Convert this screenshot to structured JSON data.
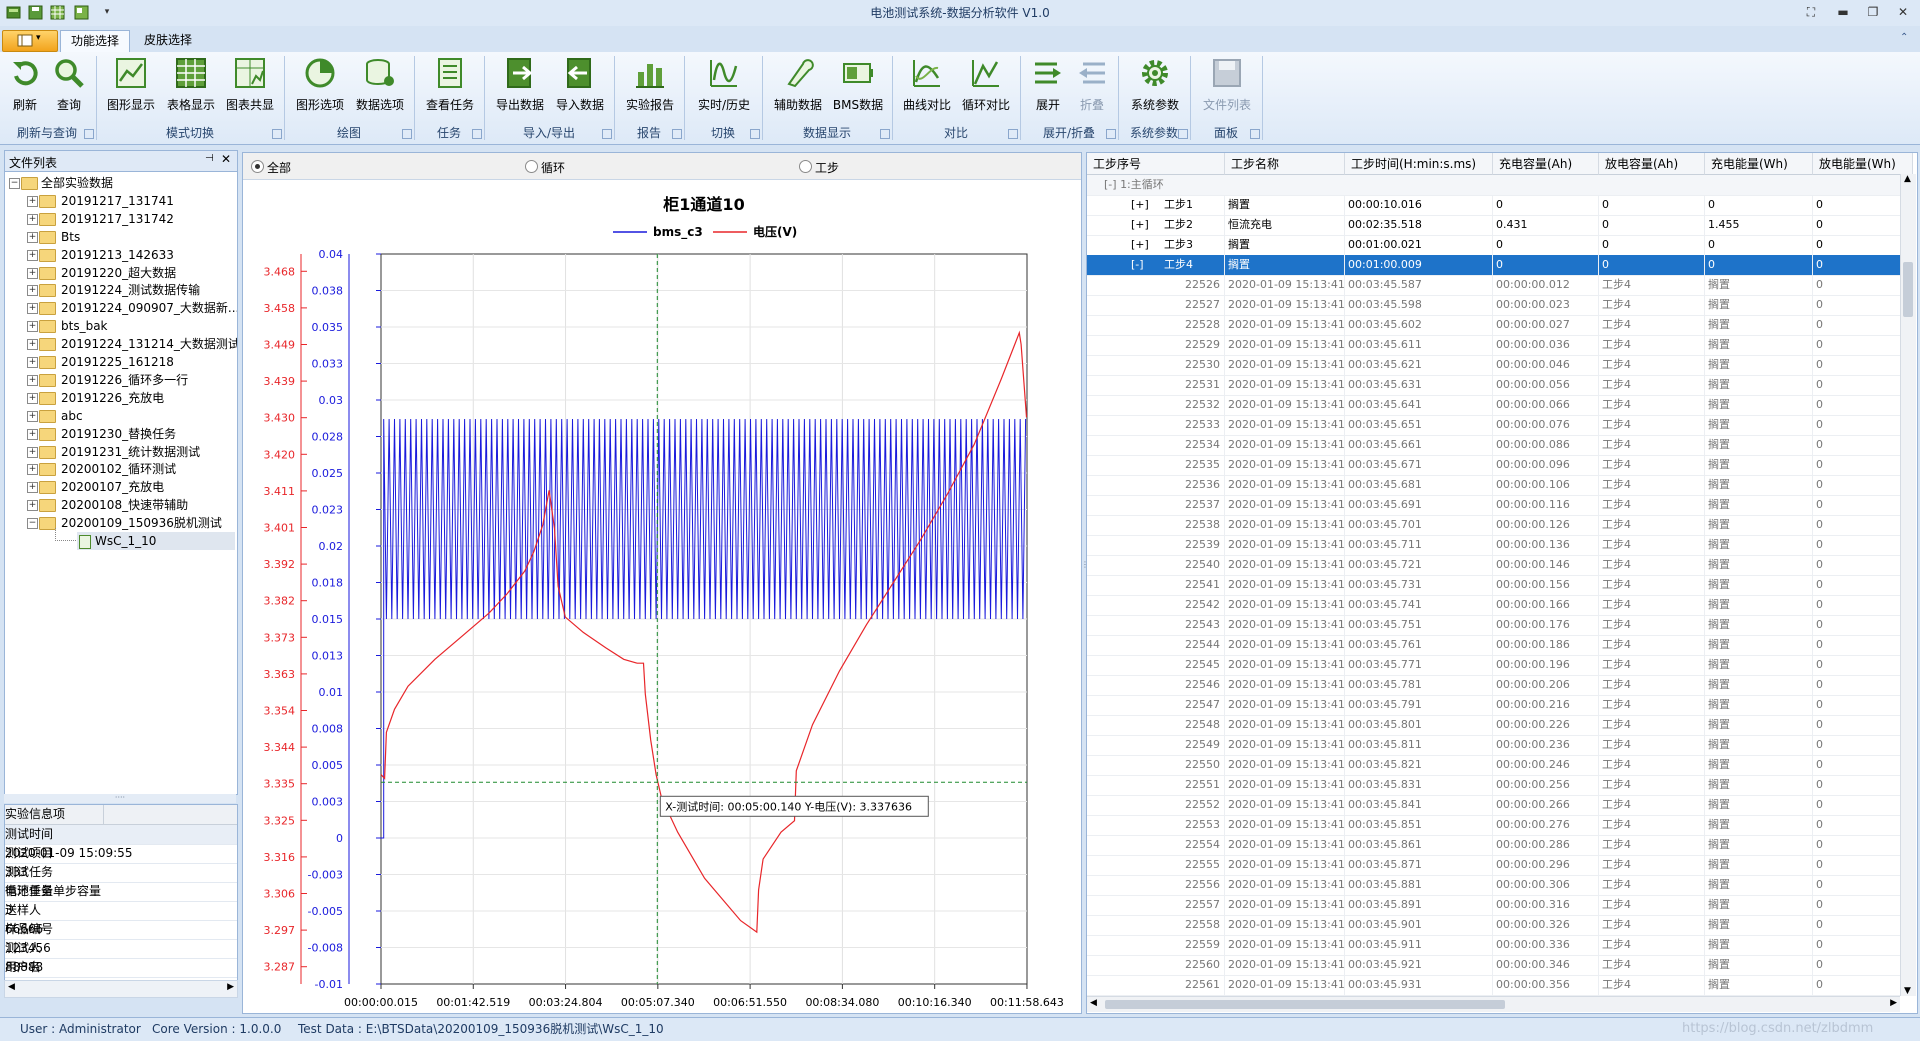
{
  "window": {
    "title": "电池测试系统-数据分析软件 V1.0"
  },
  "tabs": [
    "功能选择",
    "皮肤选择"
  ],
  "ribbon": {
    "buttons": [
      "刷新",
      "查询",
      "图形显示",
      "表格显示",
      "图表共显",
      "图形选项",
      "数据选项",
      "查看任务",
      "导出数据",
      "导入数据",
      "实验报告",
      "实时/历史",
      "辅助数据",
      "BMS数据",
      "曲线对比",
      "循环对比",
      "展开",
      "折叠",
      "系统参数",
      "文件列表"
    ],
    "groups": [
      "刷新与查询",
      "模式切换",
      "绘图",
      "任务",
      "导入/导出",
      "报告",
      "切换",
      "数据显示",
      "对比",
      "展开/折叠",
      "系统参数",
      "面板"
    ]
  },
  "file_list": {
    "title": "文件列表",
    "root": "全部实验数据",
    "items": [
      "20191217_131741",
      "20191217_131742",
      "Bts",
      "20191213_142633",
      "20191220_超大数据",
      "20191224_测试数据传输",
      "20191224_090907_大数据新...",
      "bts_bak",
      "20191224_131214_大数据测试",
      "20191225_161218",
      "20191226_循环多一行",
      "20191226_充放电",
      "abc",
      "20191230_替换任务",
      "20191231_统计数据测试",
      "20200102_循环测试",
      "20200107_充放电",
      "20200108_快速带辅助",
      "20200109_150936脱机测试"
    ],
    "child": "WsC_1_10"
  },
  "info": {
    "headers": [
      "实验信息项",
      "实验信息值"
    ],
    "rows": [
      [
        "测试时间",
        "2020-01-09 15:09:55"
      ],
      [
        "测试项目",
        "333"
      ],
      [
        "测试任务",
        "循环任务单步容量"
      ],
      [
        "电池重量",
        "3"
      ],
      [
        "送样人",
        "66666"
      ],
      [
        "样品编号",
        "123456"
      ],
      [
        "测试人",
        "88888"
      ],
      [
        "用户名",
        "Debugger"
      ]
    ]
  },
  "radios": [
    "全部",
    "循环",
    "工步"
  ],
  "chart_data": {
    "type": "line",
    "title": "柜1通道10",
    "xlabel": "测试时间",
    "x_ticks": [
      "00:00:00.015",
      "00:01:42.519",
      "00:03:24.804",
      "00:05:07.340",
      "00:06:51.550",
      "00:08:34.080",
      "00:10:16.340",
      "00:11:58.643"
    ],
    "y_left_ticks": [
      "3.468",
      "3.458",
      "3.449",
      "3.439",
      "3.430",
      "3.420",
      "3.411",
      "3.401",
      "3.392",
      "3.382",
      "3.373",
      "3.363",
      "3.354",
      "3.344",
      "3.335",
      "3.325",
      "3.316",
      "3.306",
      "3.297",
      "3.287"
    ],
    "y_right_ticks": [
      "0.04",
      "0.038",
      "0.035",
      "0.033",
      "0.03",
      "0.028",
      "0.025",
      "0.023",
      "0.02",
      "0.018",
      "0.015",
      "0.013",
      "0.01",
      "0.008",
      "0.005",
      "0.003",
      "0",
      "-0.003",
      "-0.005",
      "-0.008",
      "-0.01"
    ],
    "ylim_left": [
      3.2825,
      3.4725
    ],
    "ylim_right": [
      -0.01,
      0.04
    ],
    "xlim_seconds": [
      0,
      718.6
    ],
    "series": [
      {
        "name": "bms_c3",
        "color": "#1a1adc",
        "axis": "right",
        "pattern": {
          "low": 0.015,
          "high": 0.0287,
          "start": 3,
          "period": 6
        }
      },
      {
        "name": "电压(V)",
        "color": "#e8262a",
        "axis": "left",
        "points": [
          [
            0,
            3.337
          ],
          [
            4,
            3.336
          ],
          [
            6,
            3.348
          ],
          [
            15,
            3.354
          ],
          [
            30,
            3.36
          ],
          [
            60,
            3.367
          ],
          [
            90,
            3.373
          ],
          [
            120,
            3.379
          ],
          [
            140,
            3.384
          ],
          [
            160,
            3.39
          ],
          [
            170,
            3.395
          ],
          [
            180,
            3.402
          ],
          [
            187,
            3.411
          ],
          [
            193,
            3.401
          ],
          [
            197,
            3.386
          ],
          [
            205,
            3.378
          ],
          [
            225,
            3.374
          ],
          [
            250,
            3.37
          ],
          [
            270,
            3.367
          ],
          [
            285,
            3.366
          ],
          [
            292,
            3.366
          ],
          [
            294,
            3.358
          ],
          [
            300,
            3.346
          ],
          [
            306,
            3.337
          ],
          [
            312,
            3.331
          ],
          [
            330,
            3.322
          ],
          [
            360,
            3.31
          ],
          [
            400,
            3.299
          ],
          [
            418,
            3.296
          ],
          [
            420,
            3.307
          ],
          [
            425,
            3.315
          ],
          [
            445,
            3.322
          ],
          [
            460,
            3.325
          ],
          [
            462,
            3.338
          ],
          [
            480,
            3.35
          ],
          [
            510,
            3.364
          ],
          [
            540,
            3.376
          ],
          [
            570,
            3.387
          ],
          [
            600,
            3.398
          ],
          [
            630,
            3.41
          ],
          [
            660,
            3.423
          ],
          [
            690,
            3.44
          ],
          [
            710,
            3.452
          ],
          [
            712,
            3.449
          ],
          [
            718,
            3.43
          ]
        ]
      }
    ],
    "crosshair": {
      "x_seconds": 307.34,
      "y": 3.335
    },
    "tooltip": "X-测试时间: 00:05:00.140  Y-电压(V): 3.337636",
    "grid": true,
    "legend": "top-center"
  },
  "grid": {
    "headers": [
      "工步序号",
      "工步名称",
      "工步时间(H:min:s.ms)",
      "充电容量(Ah)",
      "放电容量(Ah)",
      "充电能量(Wh)",
      "放电能量(Wh)"
    ],
    "group_row": "1:主循环",
    "step_rows": [
      [
        "[+]",
        "工步1",
        "搁置",
        "00:00:10.016",
        "0",
        "0",
        "0",
        "0"
      ],
      [
        "[+]",
        "工步2",
        "恒流充电",
        "00:02:35.518",
        "0.431",
        "0",
        "1.455",
        "0"
      ],
      [
        "[+]",
        "工步3",
        "搁置",
        "00:01:00.021",
        "0",
        "0",
        "0",
        "0"
      ],
      [
        "[-]",
        "工步4",
        "搁置",
        "00:01:00.009",
        "0",
        "0",
        "0",
        "0"
      ]
    ],
    "detail_start": 22526,
    "detail_rows": [
      [
        "22526",
        "2020-01-09 15:13:41",
        "00:03:45.587",
        "00:00:00.012",
        "工步4",
        "搁置",
        "0"
      ],
      [
        "22527",
        "2020-01-09 15:13:41",
        "00:03:45.598",
        "00:00:00.023",
        "工步4",
        "搁置",
        "0"
      ],
      [
        "22528",
        "2020-01-09 15:13:41",
        "00:03:45.602",
        "00:00:00.027",
        "工步4",
        "搁置",
        "0"
      ],
      [
        "22529",
        "2020-01-09 15:13:41",
        "00:03:45.611",
        "00:00:00.036",
        "工步4",
        "搁置",
        "0"
      ],
      [
        "22530",
        "2020-01-09 15:13:41",
        "00:03:45.621",
        "00:00:00.046",
        "工步4",
        "搁置",
        "0"
      ],
      [
        "22531",
        "2020-01-09 15:13:41",
        "00:03:45.631",
        "00:00:00.056",
        "工步4",
        "搁置",
        "0"
      ],
      [
        "22532",
        "2020-01-09 15:13:41",
        "00:03:45.641",
        "00:00:00.066",
        "工步4",
        "搁置",
        "0"
      ],
      [
        "22533",
        "2020-01-09 15:13:41",
        "00:03:45.651",
        "00:00:00.076",
        "工步4",
        "搁置",
        "0"
      ],
      [
        "22534",
        "2020-01-09 15:13:41",
        "00:03:45.661",
        "00:00:00.086",
        "工步4",
        "搁置",
        "0"
      ],
      [
        "22535",
        "2020-01-09 15:13:41",
        "00:03:45.671",
        "00:00:00.096",
        "工步4",
        "搁置",
        "0"
      ],
      [
        "22536",
        "2020-01-09 15:13:41",
        "00:03:45.681",
        "00:00:00.106",
        "工步4",
        "搁置",
        "0"
      ],
      [
        "22537",
        "2020-01-09 15:13:41",
        "00:03:45.691",
        "00:00:00.116",
        "工步4",
        "搁置",
        "0"
      ],
      [
        "22538",
        "2020-01-09 15:13:41",
        "00:03:45.701",
        "00:00:00.126",
        "工步4",
        "搁置",
        "0"
      ],
      [
        "22539",
        "2020-01-09 15:13:41",
        "00:03:45.711",
        "00:00:00.136",
        "工步4",
        "搁置",
        "0"
      ],
      [
        "22540",
        "2020-01-09 15:13:41",
        "00:03:45.721",
        "00:00:00.146",
        "工步4",
        "搁置",
        "0"
      ],
      [
        "22541",
        "2020-01-09 15:13:41",
        "00:03:45.731",
        "00:00:00.156",
        "工步4",
        "搁置",
        "0"
      ],
      [
        "22542",
        "2020-01-09 15:13:41",
        "00:03:45.741",
        "00:00:00.166",
        "工步4",
        "搁置",
        "0"
      ],
      [
        "22543",
        "2020-01-09 15:13:41",
        "00:03:45.751",
        "00:00:00.176",
        "工步4",
        "搁置",
        "0"
      ],
      [
        "22544",
        "2020-01-09 15:13:41",
        "00:03:45.761",
        "00:00:00.186",
        "工步4",
        "搁置",
        "0"
      ],
      [
        "22545",
        "2020-01-09 15:13:41",
        "00:03:45.771",
        "00:00:00.196",
        "工步4",
        "搁置",
        "0"
      ],
      [
        "22546",
        "2020-01-09 15:13:41",
        "00:03:45.781",
        "00:00:00.206",
        "工步4",
        "搁置",
        "0"
      ],
      [
        "22547",
        "2020-01-09 15:13:41",
        "00:03:45.791",
        "00:00:00.216",
        "工步4",
        "搁置",
        "0"
      ],
      [
        "22548",
        "2020-01-09 15:13:41",
        "00:03:45.801",
        "00:00:00.226",
        "工步4",
        "搁置",
        "0"
      ],
      [
        "22549",
        "2020-01-09 15:13:41",
        "00:03:45.811",
        "00:00:00.236",
        "工步4",
        "搁置",
        "0"
      ],
      [
        "22550",
        "2020-01-09 15:13:41",
        "00:03:45.821",
        "00:00:00.246",
        "工步4",
        "搁置",
        "0"
      ],
      [
        "22551",
        "2020-01-09 15:13:41",
        "00:03:45.831",
        "00:00:00.256",
        "工步4",
        "搁置",
        "0"
      ],
      [
        "22552",
        "2020-01-09 15:13:41",
        "00:03:45.841",
        "00:00:00.266",
        "工步4",
        "搁置",
        "0"
      ],
      [
        "22553",
        "2020-01-09 15:13:41",
        "00:03:45.851",
        "00:00:00.276",
        "工步4",
        "搁置",
        "0"
      ],
      [
        "22554",
        "2020-01-09 15:13:41",
        "00:03:45.861",
        "00:00:00.286",
        "工步4",
        "搁置",
        "0"
      ],
      [
        "22555",
        "2020-01-09 15:13:41",
        "00:03:45.871",
        "00:00:00.296",
        "工步4",
        "搁置",
        "0"
      ],
      [
        "22556",
        "2020-01-09 15:13:41",
        "00:03:45.881",
        "00:00:00.306",
        "工步4",
        "搁置",
        "0"
      ],
      [
        "22557",
        "2020-01-09 15:13:41",
        "00:03:45.891",
        "00:00:00.316",
        "工步4",
        "搁置",
        "0"
      ],
      [
        "22558",
        "2020-01-09 15:13:41",
        "00:03:45.901",
        "00:00:00.326",
        "工步4",
        "搁置",
        "0"
      ],
      [
        "22559",
        "2020-01-09 15:13:41",
        "00:03:45.911",
        "00:00:00.336",
        "工步4",
        "搁置",
        "0"
      ],
      [
        "22560",
        "2020-01-09 15:13:41",
        "00:03:45.921",
        "00:00:00.346",
        "工步4",
        "搁置",
        "0"
      ],
      [
        "22561",
        "2020-01-09 15:13:41",
        "00:03:45.931",
        "00:00:00.356",
        "工步4",
        "搁置",
        "0"
      ]
    ]
  },
  "status": {
    "user": "User : Administrator",
    "core": "Core Version : 1.0.0.0",
    "test": "Test Data : E:\\BTSData\\20200109_150936脱机测试\\WsC_1_10",
    "watermark": "https://blog.csdn.net/zlbdmm"
  },
  "colors": {
    "accent": "#1e73c9",
    "ribbon_bg": "#dde9f7",
    "voltage": "#e8262a",
    "bms": "#1a1adc"
  }
}
